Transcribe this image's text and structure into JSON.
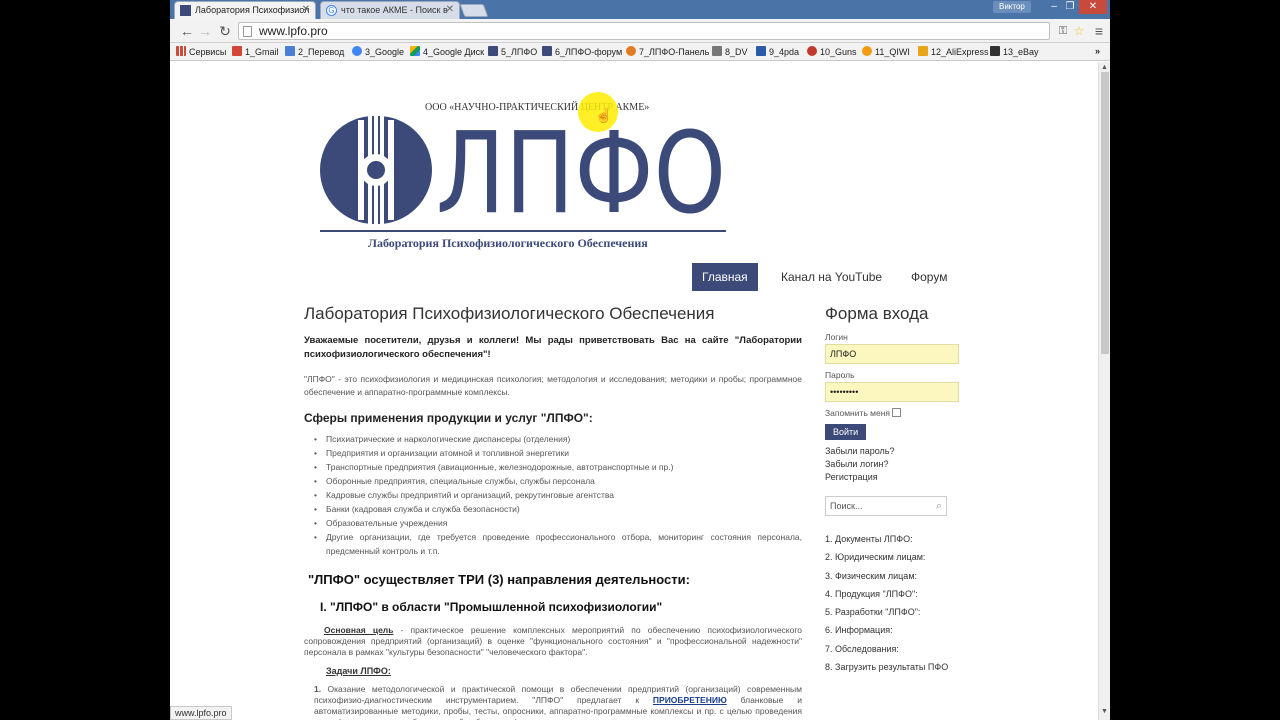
{
  "browser": {
    "tabs": [
      {
        "title": "Лаборатория Психофизиол",
        "active": true
      },
      {
        "title": "что такое АКМЕ - Поиск в",
        "active": false
      }
    ],
    "user": "Виктор",
    "url": "www.lpfo.pro",
    "status_url": "www.lpfo.pro"
  },
  "bookmarks": [
    {
      "label": "Сервисы",
      "icon": "apps-icon",
      "color": "#d04a3a"
    },
    {
      "label": "1_Gmail",
      "icon": "gmail-icon",
      "color": "#d44638"
    },
    {
      "label": "2_Перевод",
      "icon": "translate-icon",
      "color": "#4a7fd4"
    },
    {
      "label": "3_Google",
      "icon": "google-icon",
      "color": "#4285f4"
    },
    {
      "label": "4_Google Диск",
      "icon": "drive-icon",
      "color": "#f4b400"
    },
    {
      "label": "5_ЛПФО",
      "icon": "lpfo-icon",
      "color": "#3b4a78"
    },
    {
      "label": "6_ЛПФО-форум",
      "icon": "lpfo-forum-icon",
      "color": "#3b4a78"
    },
    {
      "label": "7_ЛПФО-Панель",
      "icon": "joomla-icon",
      "color": "#e07b22"
    },
    {
      "label": "8_DV",
      "icon": "dv-icon",
      "color": "#777777"
    },
    {
      "label": "9_4pda",
      "icon": "4pda-icon",
      "color": "#2a5aa8"
    },
    {
      "label": "10_Guns",
      "icon": "guns-icon",
      "color": "#c0392b"
    },
    {
      "label": "11_QIWI",
      "icon": "qiwi-icon",
      "color": "#f39c12"
    },
    {
      "label": "12_AliExpress",
      "icon": "aliexpress-icon",
      "color": "#e8a317"
    },
    {
      "label": "13_eBay",
      "icon": "ebay-icon",
      "color": "#333333"
    }
  ],
  "header": {
    "company": "ООО «НАУЧНО-ПРАКТИЧЕСКИЙ ЦЕНТР АКМЕ»",
    "logo_text": "ЛПФО",
    "lab_title": "Лаборатория Психофизиологического Обеспечения",
    "brand_color": "#3b4a78"
  },
  "nav": {
    "items": [
      "Главная",
      "Канал на YouTube",
      "Форум"
    ],
    "active": "Главная"
  },
  "main": {
    "title": "Лаборатория Психофизиологического Обеспечения",
    "intro": "Уважаемые посетители, друзья и коллеги! Мы рады приветствовать Вас на сайте \"Лаборатории психофизиологического обеспечения\"!",
    "desc": "\"ЛПФО\" - это психофизиология и медицинская психология; методология и исследования; методики и пробы; программное обеспечение и аппаратно-программные комплексы.",
    "spheres_title": "Сферы применения продукции и услуг \"ЛПФО\":",
    "spheres": [
      "Психиатрические и наркологические диспансеры (отделения)",
      "Предприятия и организации атомной и топливной энергетики",
      "Транспортные предприятия (авиационные, железнодорожные, автотранспортные и пр.)",
      "Оборонные предприятия, специальные службы, службы персонала",
      "Кадровые службы предприятий и организаций, рекрутинговые агентства",
      "Банки (кадровая служба и служба безопасности)",
      "Образовательные учреждения",
      "Другие организации, где требуется проведение профессионального отбора, мониторинг состояния персонала, предсменный контроль и т.п."
    ],
    "directions_title": "\"ЛПФО\" осуществляет ТРИ (3) направления деятельности:",
    "direction1": "I. \"ЛПФО\" в области \"Промышленной психофизиологии\"",
    "goal_label": "Основная цель",
    "goal_text": " - практическое решение комплексных мероприятий по обеспечению психофизиологического сопровождения предприятий (организаций) в оценке \"функционального состояния\" и \"профессиональной надежности\" персонала в рамках \"культуры безопасности\" \"человеческого фактора\".",
    "tasks_label": "Задачи ЛПФО:",
    "task1_num": "1.",
    "task1_a": " Оказание методологической и практической помощи в обеспечении предприятий (организаций) современным психофизио-диагностическим инструментарием. \"ЛПФО\" предлагает к ",
    "task1_link": "ПРИОБРЕТЕНИЮ",
    "task1_b": " бланковые и автоматизированные методики, пробы, тесты, опросники, аппаратно-программные комплексы и пр. с целью проведения психофизиологических обследований работников (периодического мониторинга, входного"
  },
  "sidebar": {
    "login_title": "Форма входа",
    "login_label": "Логин",
    "login_value": "ЛПФО",
    "password_label": "Пароль",
    "password_value": "•••••••••",
    "remember_label": "Запомнить меня",
    "login_button": "Войти",
    "forgot_password": "Забыли пароль?",
    "forgot_login": "Забыли логин?",
    "register": "Регистрация",
    "search_placeholder": "Поиск...",
    "sections": [
      "1. Документы ЛПФО:",
      "2. Юридическим лицам:",
      "3. Физическим лицам:",
      "4. Продукция \"ЛПФО\":",
      "5. Разработки \"ЛПФО\":",
      "6. Информация:",
      "7. Обследования:",
      "8. Загрузить результаты ПФО"
    ]
  }
}
